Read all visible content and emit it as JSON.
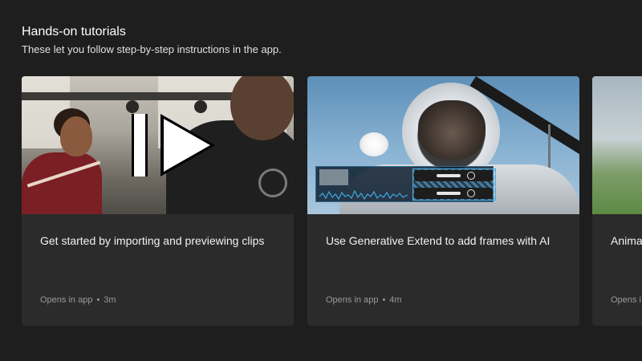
{
  "section": {
    "title": "Hands-on tutorials",
    "subtitle": "These let you follow step-by-step instructions in the app."
  },
  "cards": [
    {
      "title": "Get started by importing and previewing clips",
      "meta_source": "Opens in app",
      "meta_separator": "•",
      "meta_duration": "3m",
      "thumbnail_icon": "play-icon"
    },
    {
      "title": "Use Generative Extend to add frames with AI",
      "meta_source": "Opens in app",
      "meta_separator": "•",
      "meta_duration": "4m"
    },
    {
      "title": "Anima",
      "meta_source": "Opens i"
    }
  ],
  "colors": {
    "background": "#1e1e1e",
    "card": "#2b2b2b",
    "meta_text": "#9a9a9a"
  }
}
